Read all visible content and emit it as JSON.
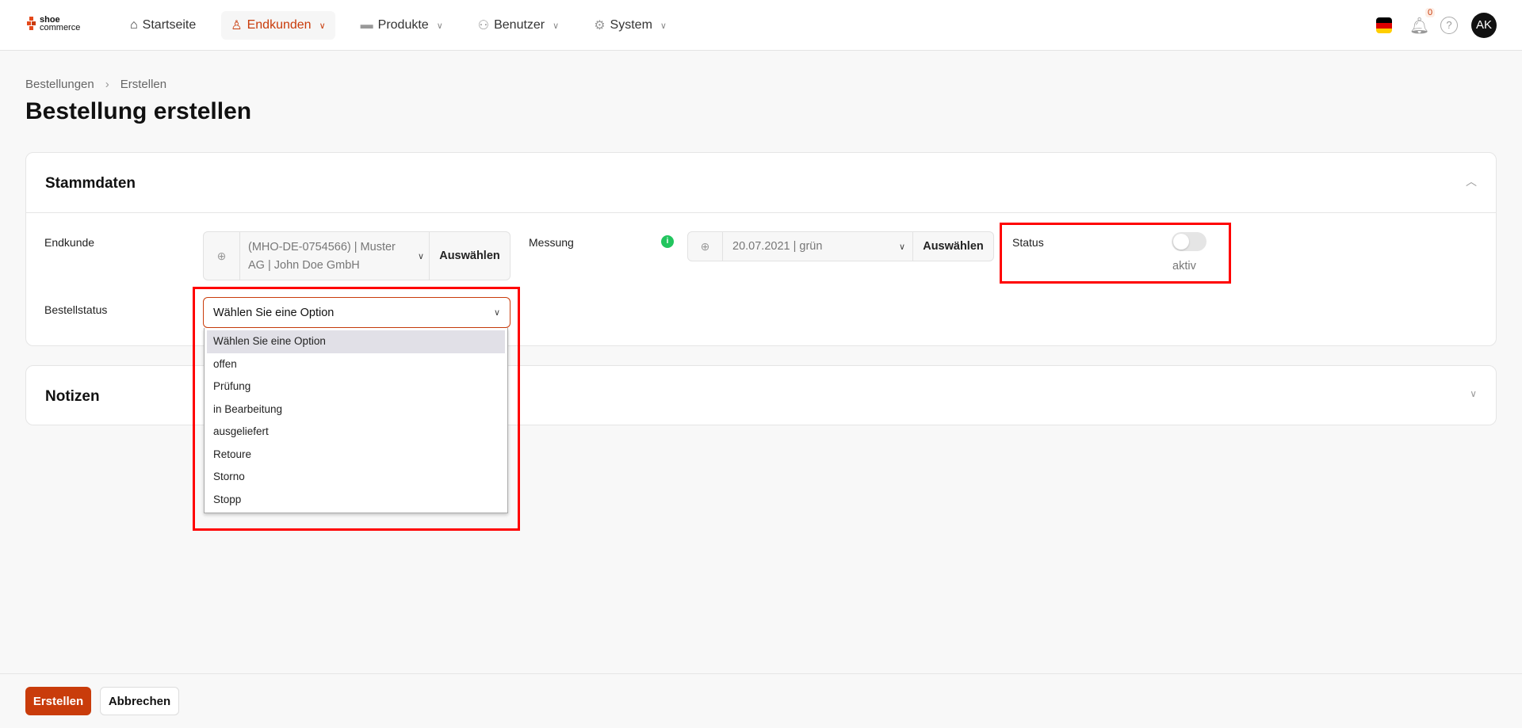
{
  "header": {
    "logo_line1": "shoe",
    "logo_line2": "commerce",
    "nav": [
      {
        "label": "Startseite",
        "icon": "home-icon"
      },
      {
        "label": "Endkunden",
        "icon": "user-icon",
        "active": true
      },
      {
        "label": "Produkte",
        "icon": "shoe-icon"
      },
      {
        "label": "Benutzer",
        "icon": "users-icon"
      },
      {
        "label": "System",
        "icon": "gear-icon"
      }
    ],
    "notification_count": "0",
    "help": "?",
    "avatar": "AK"
  },
  "breadcrumb": [
    "Bestellungen",
    "Erstellen"
  ],
  "page_title": "Bestellung erstellen",
  "stammdaten": {
    "title": "Stammdaten",
    "endkunde": {
      "label": "Endkunde",
      "value": "(MHO-DE-0754566) | Muster AG | John Doe GmbH",
      "button": "Auswählen"
    },
    "messung": {
      "label": "Messung",
      "info": "i",
      "value": "20.07.2021 | grün",
      "button": "Auswählen"
    },
    "status": {
      "label": "Status",
      "toggle_on": false,
      "toggle_label": "aktiv"
    },
    "bestellstatus": {
      "label": "Bestellstatus",
      "selected": "Wählen Sie eine Option",
      "options": [
        "Wählen Sie eine Option",
        "offen",
        "Prüfung",
        "in Bearbeitung",
        "ausgeliefert",
        "Retoure",
        "Storno",
        "Stopp"
      ]
    }
  },
  "notizen": {
    "title": "Notizen"
  },
  "footer": {
    "create": "Erstellen",
    "cancel": "Abbrechen"
  },
  "colors": {
    "accent": "#c93c0b",
    "highlight": "#ff0000"
  }
}
